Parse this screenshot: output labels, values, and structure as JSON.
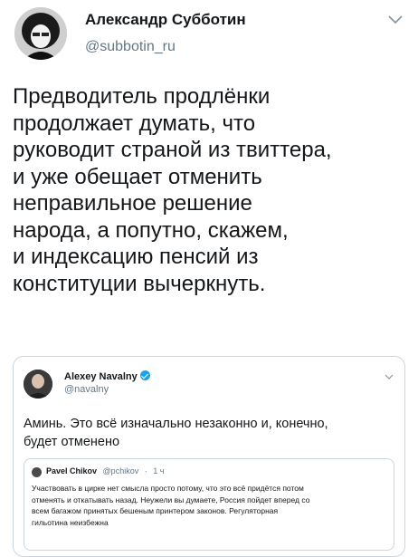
{
  "tweet": {
    "author_name": "Александр Субботин",
    "author_handle": "@subbotin_ru",
    "text_lines": [
      "Предводитель продлёнки",
      "продолжает думать, что",
      "руководит страной из твиттера,",
      "и уже обещает отменить",
      "неправильное решение",
      "народа, а попутно, скажем,",
      "и индексацию пенсий из",
      "конституции вычеркнуть."
    ]
  },
  "quoted": {
    "author_name": "Alexey Navalny",
    "author_handle": "@navalny",
    "text_lines": [
      "Аминь. Это всё изначально незаконно и, конечно,",
      "будет отменено"
    ],
    "nested": {
      "author_name": "Pavel Chikov",
      "author_handle": "@pchikov",
      "separator": "·",
      "time": "1 ч",
      "text_lines": [
        "Участвовать в цирке нет смысла просто потому, что это всё придётся потом",
        "отменять и откатывать назад. Неужели вы думаете, Россия пойдет вперед со",
        "всем багажом принятых бешеным принтером законов. Регуляторная",
        "гильотина неизбежна"
      ]
    }
  },
  "icons": {
    "main_menu": "chevron-down-icon",
    "quote_menu": "chevron-down-icon",
    "verified": "verified-badge-icon"
  },
  "colors": {
    "text": "#14171a",
    "secondary": "#657786",
    "border": "#ccd6dd",
    "verified": "#1da1f2"
  }
}
